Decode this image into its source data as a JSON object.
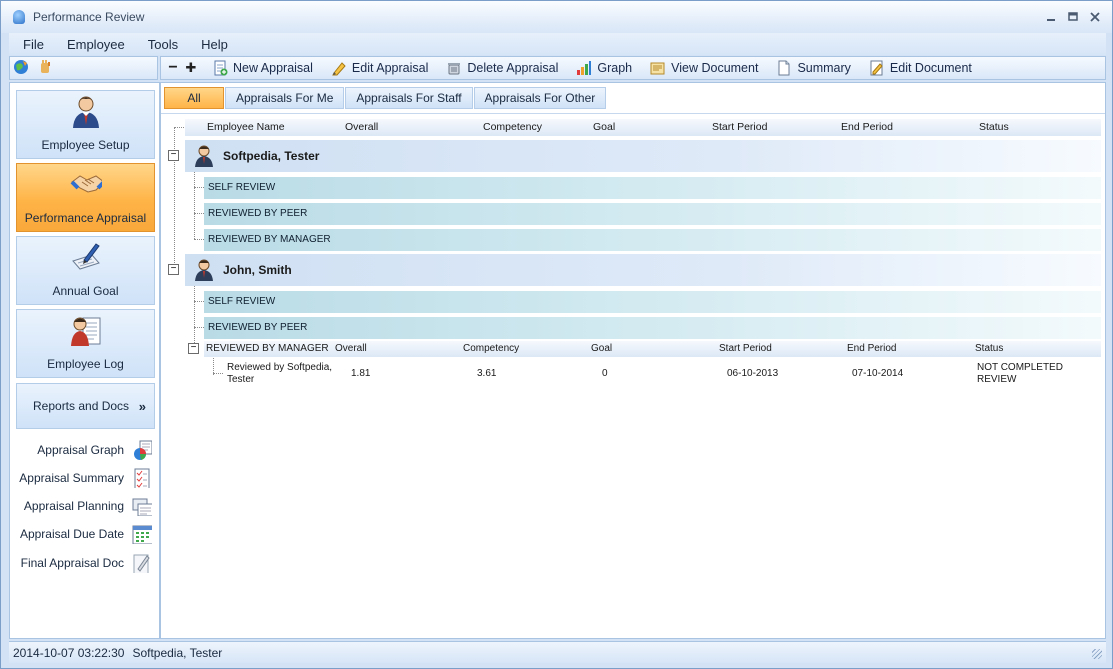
{
  "window": {
    "title": "Performance Review"
  },
  "menu": [
    "File",
    "Employee",
    "Tools",
    "Help"
  ],
  "toolbar": {
    "collapse_symbol": "−",
    "expand_symbol": "✚",
    "buttons": [
      {
        "label": "New Appraisal",
        "icon": "new-document-icon"
      },
      {
        "label": "Edit Appraisal",
        "icon": "pencil-icon"
      },
      {
        "label": "Delete Appraisal",
        "icon": "delete-icon"
      },
      {
        "label": "Graph",
        "icon": "bar-chart-icon"
      },
      {
        "label": "View Document",
        "icon": "view-document-icon"
      },
      {
        "label": "Summary",
        "icon": "summary-icon"
      },
      {
        "label": "Edit Document",
        "icon": "edit-document-icon"
      }
    ]
  },
  "nav": {
    "items": [
      {
        "label": "Employee Setup",
        "icon": "employee-icon"
      },
      {
        "label": "Performance Appraisal",
        "icon": "handshake-icon",
        "active": true
      },
      {
        "label": "Annual Goal",
        "icon": "writing-icon"
      },
      {
        "label": "Employee Log",
        "icon": "employee-log-icon"
      }
    ],
    "reports": {
      "label": "Reports and Docs",
      "chevron": "»"
    },
    "sub_items": [
      {
        "label": "Appraisal Graph",
        "icon": "graph-icon"
      },
      {
        "label": "Appraisal Summary",
        "icon": "checklist-icon"
      },
      {
        "label": "Appraisal Planning",
        "icon": "planning-icon"
      },
      {
        "label": "Appraisal Due Date",
        "icon": "calendar-icon"
      },
      {
        "label": "Final Appraisal Doc",
        "icon": "final-doc-icon"
      }
    ]
  },
  "filters": [
    {
      "label": "All",
      "active": true
    },
    {
      "label": "Appraisals For Me"
    },
    {
      "label": "Appraisals For Staff"
    },
    {
      "label": "Appraisals For Other"
    }
  ],
  "grid": {
    "columns": [
      "Employee Name",
      "Overall",
      "Competency",
      "Goal",
      "Start Period",
      "End Period",
      "Status"
    ],
    "toggle_collapse": "−",
    "employees": [
      {
        "name": "Softpedia, Tester",
        "reviews": [
          "SELF REVIEW",
          "REVIEWED BY PEER",
          "REVIEWED BY MANAGER"
        ]
      },
      {
        "name": "John, Smith",
        "reviews": [
          "SELF REVIEW",
          "REVIEWED BY PEER"
        ],
        "expanded_review": {
          "label": "REVIEWED BY MANAGER",
          "columns": [
            "Overall",
            "Competency",
            "Goal",
            "Start Period",
            "End Period",
            "Status"
          ],
          "row": {
            "reviewer_line1": "Reviewed by Softpedia,",
            "reviewer_line2": "Tester",
            "overall": "1.81",
            "competency": "3.61",
            "goal": "0",
            "start": "06-10-2013",
            "end": "07-10-2014",
            "status_line1": "NOT COMPLETED",
            "status_line2": "REVIEW"
          }
        }
      }
    ]
  },
  "status": {
    "datetime": "2014-10-07 03:22:30",
    "user": "Softpedia, Tester"
  },
  "colors": {
    "accent_orange": "#ffb447",
    "frame_blue": "#a9c3e3",
    "review_row": "#b9dbe6"
  }
}
